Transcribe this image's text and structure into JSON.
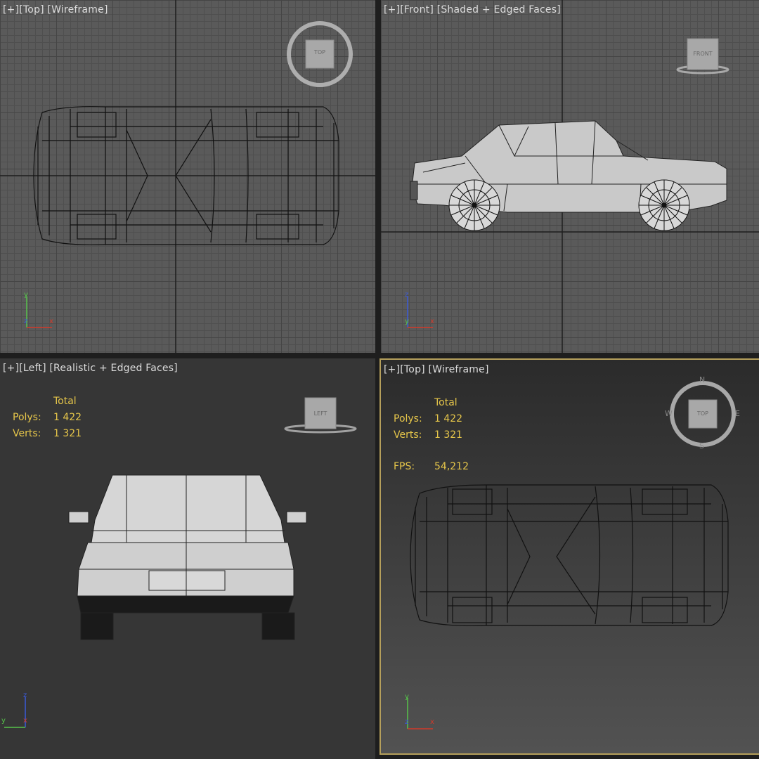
{
  "viewports": {
    "top_left": {
      "plus": "[+]",
      "view": "[Top]",
      "shading": "[Wireframe]",
      "viewcube_label": "TOP"
    },
    "top_right": {
      "plus": "[+]",
      "view": "[Front]",
      "shading": "[Shaded + Edged Faces]",
      "viewcube_label": "FRONT"
    },
    "bottom_left": {
      "plus": "[+]",
      "view": "[Left]",
      "shading": "[Realistic + Edged Faces]",
      "viewcube_label": "LEFT",
      "stats": {
        "header": "Total",
        "polys_label": "Polys:",
        "polys": "1 422",
        "verts_label": "Verts:",
        "verts": "1 321"
      }
    },
    "bottom_right": {
      "plus": "[+]",
      "view": "[Top]",
      "shading": "[Wireframe]",
      "viewcube_label": "TOP",
      "compass": {
        "n": "N",
        "s": "S",
        "e": "E",
        "w": "W"
      },
      "active": true,
      "stats": {
        "header": "Total",
        "polys_label": "Polys:",
        "polys": "1 422",
        "verts_label": "Verts:",
        "verts": "1 321",
        "fps_label": "FPS:",
        "fps": "54,212"
      }
    }
  },
  "axes": {
    "x": "x",
    "y": "y",
    "z": "z"
  },
  "colors": {
    "x_axis": "#d23a2a",
    "y_axis": "#56c24a",
    "z_axis": "#3a5ad8",
    "active_border": "#b59f5b",
    "stats_text": "#e6c64a"
  }
}
